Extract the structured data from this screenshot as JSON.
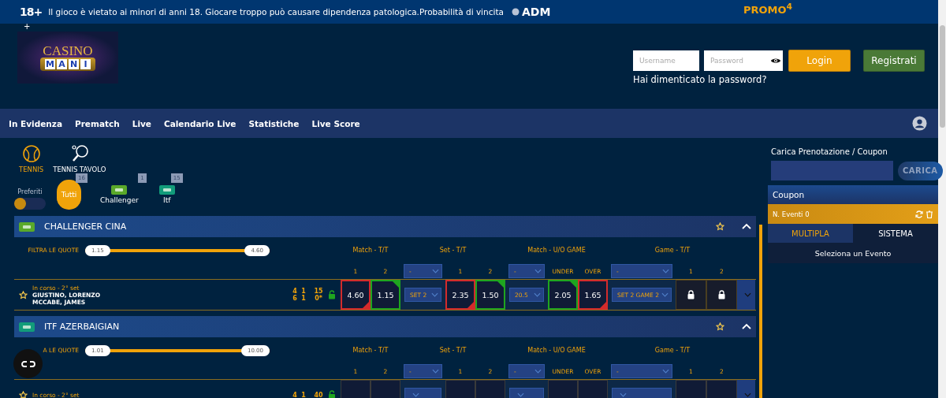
{
  "topbar": {
    "age": "18+",
    "notice": "Il gioco è vietato ai minori di anni 18. Giocare troppo può causare dipendenza patologica.Probabilità di vincita",
    "regulator": "ADM",
    "promo": "PROMO$^{4}$"
  },
  "header": {
    "plus": "+"
  },
  "logo": {
    "word": "CASINO",
    "reels": [
      "M",
      "A",
      "N",
      "I"
    ]
  },
  "login": {
    "username": {
      "placeholder": "Username"
    },
    "password": {
      "placeholder": "Password"
    },
    "login_button": "Login",
    "register_button": "Registrati",
    "forgot": "Hai dimenticato la password?"
  },
  "nav": {
    "items": [
      "In Evidenza",
      "Prematch",
      "Live",
      "Calendario Live",
      "Statistiche",
      "Live Score"
    ]
  },
  "sports": [
    {
      "kind": "tennis",
      "label": "TENNIS",
      "selected": true
    },
    {
      "kind": "table-tennis",
      "label": "TENNIS TAVOLO",
      "selected": false
    }
  ],
  "favorites": {
    "label": "Preferiti",
    "on": false
  },
  "categories": [
    {
      "kind": "all",
      "label": "Tutti",
      "count": "16",
      "selected": true
    },
    {
      "kind": "challenger",
      "label": "Challenger",
      "count": "1",
      "selected": false
    },
    {
      "kind": "itf",
      "label": "Itf",
      "count": "15",
      "selected": false
    }
  ],
  "sections": [
    {
      "kind": "challenger",
      "title": "CHALLENGER CINA",
      "filter": {
        "label": "FILTRA LE QUOTE",
        "min": "1.15",
        "max": "4.60",
        "level": 1
      },
      "markets": [
        {
          "title": "Match - T/T",
          "columns": [
            {
              "kind": "label",
              "text": "1"
            },
            {
              "kind": "label",
              "text": "2"
            }
          ]
        },
        {
          "title": "Set - T/T",
          "columns": [
            {
              "kind": "select",
              "text": "-"
            },
            {
              "kind": "label",
              "text": "1"
            },
            {
              "kind": "label",
              "text": "2"
            }
          ]
        },
        {
          "title": "Match - U/O GAME",
          "columns": [
            {
              "kind": "select",
              "text": "-"
            },
            {
              "kind": "label",
              "text": "UNDER"
            },
            {
              "kind": "label",
              "text": "OVER"
            }
          ]
        },
        {
          "title": "Game - T/T",
          "columns": [
            {
              "kind": "select",
              "text": "-"
            },
            {
              "kind": "label",
              "text": "1"
            },
            {
              "kind": "label",
              "text": "2"
            }
          ]
        }
      ],
      "events": [
        {
          "status": "In corso - 2° set",
          "players": [
            "GIUSTINO, LORENZO",
            "MCCABE, JAMES"
          ],
          "score": [
            [
              "4",
              "1",
              "15"
            ],
            [
              "6",
              "1",
              "0*"
            ]
          ],
          "locked": false,
          "markets": [
            [
              {
                "kind": "odd",
                "value": "4.60",
                "color": "#d32b2b"
              },
              {
                "kind": "odd",
                "value": "1.15",
                "color": "#1fa51f"
              }
            ],
            [
              {
                "kind": "select",
                "value": "SET 2"
              },
              {
                "kind": "odd",
                "value": "2.35",
                "color": "#d32b2b"
              },
              {
                "kind": "odd",
                "value": "1.50",
                "color": "#1fa51f"
              }
            ],
            [
              {
                "kind": "select",
                "value": "20.5"
              },
              {
                "kind": "odd",
                "value": "2.05",
                "color": "#1fa51f"
              },
              {
                "kind": "odd",
                "value": "1.65",
                "color": "#d32b2b"
              }
            ],
            [
              {
                "kind": "select",
                "value": "SET 2 GAME 2"
              },
              {
                "kind": "locked"
              },
              {
                "kind": "locked"
              }
            ]
          ]
        }
      ]
    },
    {
      "kind": "itf",
      "title": "ITF AZERBAIGIAN",
      "filter": {
        "label": "A LE QUOTE",
        "min": "1.01",
        "max": "10.00",
        "level": 1
      },
      "markets": [
        {
          "title": "Match - T/T",
          "columns": [
            {
              "kind": "label",
              "text": "1"
            },
            {
              "kind": "label",
              "text": "2"
            }
          ]
        },
        {
          "title": "Set - T/T",
          "columns": [
            {
              "kind": "select",
              "text": "-"
            },
            {
              "kind": "label",
              "text": "1"
            },
            {
              "kind": "label",
              "text": "2"
            }
          ]
        },
        {
          "title": "Match - U/O GAME",
          "columns": [
            {
              "kind": "select",
              "text": "-"
            },
            {
              "kind": "label",
              "text": "UNDER"
            },
            {
              "kind": "label",
              "text": "OVER"
            }
          ]
        },
        {
          "title": "Game - T/T",
          "columns": [
            {
              "kind": "select",
              "text": "-"
            },
            {
              "kind": "label",
              "text": "1"
            },
            {
              "kind": "label",
              "text": "2"
            }
          ]
        }
      ],
      "events": [
        {
          "status": "In corso - 2° set",
          "score": [
            [
              "4",
              "1",
              "40"
            ]
          ],
          "locked": false,
          "markets": [
            [
              {
                "kind": "odd"
              },
              {
                "kind": "odd"
              }
            ],
            [
              {
                "kind": "select"
              },
              {
                "kind": "odd"
              },
              {
                "kind": "odd"
              }
            ],
            [
              {
                "kind": "select"
              },
              {
                "kind": "odd"
              },
              {
                "kind": "odd"
              }
            ],
            [
              {
                "kind": "select"
              },
              {
                "kind": "odd"
              },
              {
                "kind": "odd"
              }
            ]
          ]
        }
      ]
    }
  ],
  "booking": {
    "title": "Carica Prenotazione / Coupon",
    "button": "CARICA"
  },
  "coupon": {
    "title": "Coupon",
    "events": "N. Eventi 0",
    "tabs": [
      {
        "label": "MULTIPLA",
        "selected": true
      },
      {
        "label": "SISTEMA",
        "selected": false
      }
    ],
    "empty": "Seleziona un Evento"
  }
}
